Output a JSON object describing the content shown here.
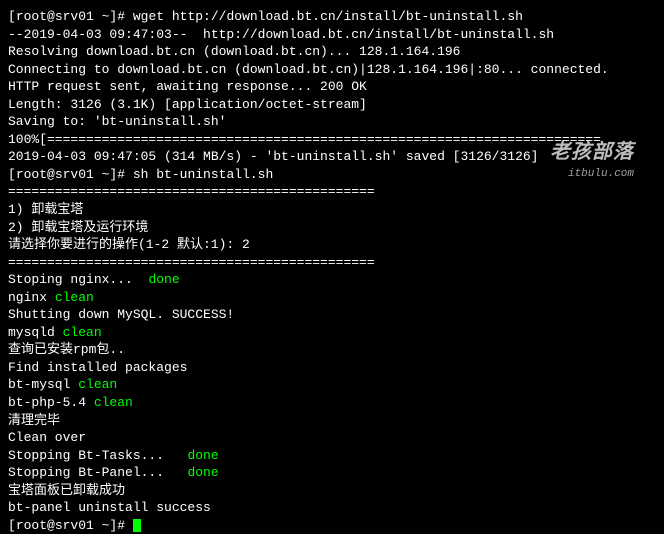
{
  "prompt1": {
    "pre": "[",
    "host": "root@srv01",
    "loc": " ~]#",
    "cmd": " wget http://download.bt.cn/install/bt-uninstall.sh"
  },
  "l1": "--2019-04-03 09:47:03--  http://download.bt.cn/install/bt-uninstall.sh",
  "l2": "Resolving download.bt.cn (download.bt.cn)... 128.1.164.196",
  "l3": "Connecting to download.bt.cn (download.bt.cn)|128.1.164.196|:80... connected.",
  "l4": "HTTP request sent, awaiting response... 200 OK",
  "l5": "Length: 3126 (3.1K) [application/octet-stream]",
  "l6": "Saving to: 'bt-uninstall.sh'",
  "blank": "",
  "progress": "100%[=======================================================================",
  "l7": "2019-04-03 09:47:05 (314 MB/s) - 'bt-uninstall.sh' saved [3126/3126]",
  "prompt2": {
    "pre": "[",
    "host": "root@srv01",
    "loc": " ~]#",
    "cmd": " sh bt-uninstall.sh"
  },
  "sep": "===============================================",
  "opt1": "1) 卸载宝塔",
  "opt2": "2) 卸载宝塔及运行环境",
  "ask": "请选择你要进行的操作(1-2 默认:1): 2",
  "sep2": "===============================================",
  "nginx": {
    "a": "Stoping nginx...  ",
    "b": "done"
  },
  "nginxClean": {
    "a": "nginx ",
    "b": "clean"
  },
  "mysqlStop": "Shutting down MySQL. SUCCESS!",
  "mysqldClean": {
    "a": "mysqld ",
    "b": "clean"
  },
  "rpm": "查询已安装rpm包..",
  "find": "Find installed packages",
  "btmysql": {
    "a": "bt-mysql ",
    "b": "clean"
  },
  "btphp": {
    "a": "bt-php-5.4 ",
    "b": "clean"
  },
  "cleanzh": "清理完毕",
  "cleanover": "Clean over",
  "tasks": {
    "a": "Stopping Bt-Tasks...   ",
    "b": "done"
  },
  "panel": {
    "a": "Stopping Bt-Panel...   ",
    "b": "done"
  },
  "successzh": "宝塔面板已卸载成功",
  "success": "bt-panel uninstall success",
  "prompt3": {
    "pre": "[",
    "host": "root@srv01",
    "loc": " ~]#",
    "cmd": " "
  },
  "watermark": {
    "top": "老孩部落",
    "bottom": "itbulu.com"
  }
}
